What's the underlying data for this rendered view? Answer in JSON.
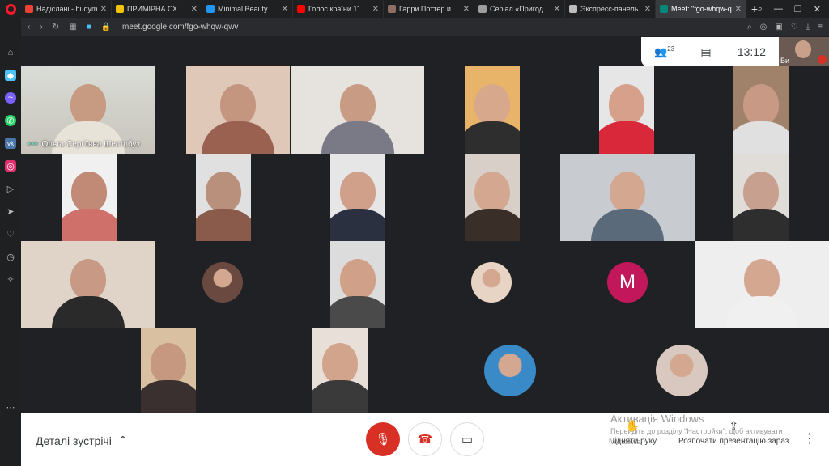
{
  "tabs": [
    {
      "label": "Надіслані - hudym",
      "color": "#ea4335"
    },
    {
      "label": "ПРИМІРНА СХЕМА",
      "color": "#f4c20d"
    },
    {
      "label": "Minimal Beauty Log",
      "color": "#2196f3"
    },
    {
      "label": "Голос країни 11 се",
      "color": "#ff0000"
    },
    {
      "label": "Гарри Поттер и Да",
      "color": "#8d6e63"
    },
    {
      "label": "Серіал «Пригоди М",
      "color": "#9e9e9e"
    },
    {
      "label": "Экспресс-панель",
      "color": "#bdbdbd"
    },
    {
      "label": "Meet: \"fgo-whqw-q",
      "color": "#00897b",
      "active": true
    }
  ],
  "browser": {
    "url": "meet.google.com/fgo-whqw-qwv"
  },
  "meeting": {
    "participants_count": "23",
    "time": "13:12",
    "presenter_name": "Ольга Сергіївна Шестобуз",
    "self_label": "Ви",
    "m_avatar_letter": "M"
  },
  "bottom": {
    "details_label": "Деталі зустрічі",
    "raise_hand_label": "Підняти руку",
    "present_label": "Розпочати презентацію зараз"
  },
  "watermark": {
    "title": "Активація Windows",
    "line2": "Перейдіть до розділу \"Настройки\", щоб активувати",
    "line3": "Windows."
  },
  "colors": {
    "accent_red": "#d93025",
    "m_avatar": "#c2185b",
    "opera_red": "#ff1b2d"
  }
}
